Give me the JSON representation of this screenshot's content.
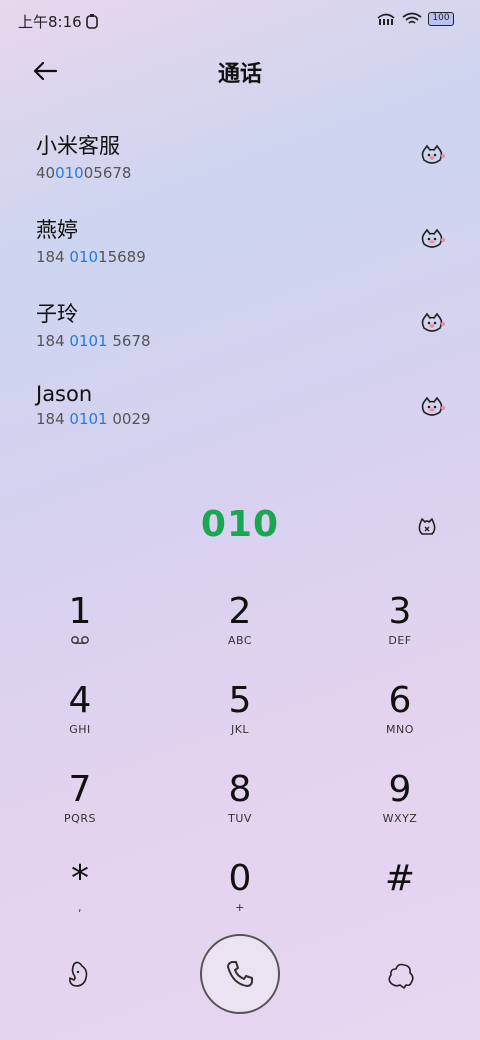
{
  "status_bar": {
    "time": "上午8:16",
    "battery": "100"
  },
  "header": {
    "title": "通话"
  },
  "contacts": [
    {
      "name": "小米客服",
      "number_pre": "40",
      "number_match": "010",
      "number_post": "05678"
    },
    {
      "name": "燕婷",
      "number_pre": "184 ",
      "number_match": "010",
      "number_post": "15689"
    },
    {
      "name": "子玲",
      "number_pre": "184 ",
      "number_match": "0101",
      "number_post": " 5678"
    },
    {
      "name": "Jason",
      "number_pre": "184 ",
      "number_match": "0101",
      "number_post": " 0029"
    }
  ],
  "dialer": {
    "input": "010"
  },
  "keypad": [
    [
      {
        "digit": "1",
        "letters": ""
      },
      {
        "digit": "2",
        "letters": "ABC"
      },
      {
        "digit": "3",
        "letters": "DEF"
      }
    ],
    [
      {
        "digit": "4",
        "letters": "GHI"
      },
      {
        "digit": "5",
        "letters": "JKL"
      },
      {
        "digit": "6",
        "letters": "MNO"
      }
    ],
    [
      {
        "digit": "7",
        "letters": "PQRS"
      },
      {
        "digit": "8",
        "letters": "TUV"
      },
      {
        "digit": "9",
        "letters": "WXYZ"
      }
    ],
    [
      {
        "digit": "*",
        "letters": ","
      },
      {
        "digit": "0",
        "letters": "+"
      },
      {
        "digit": "#",
        "letters": ""
      }
    ]
  ],
  "colors": {
    "highlight": "#2979d8",
    "dialed_text": "#1aa653"
  },
  "icons": {
    "back": "arrow-left-icon",
    "contact_action": "cat-head-icon",
    "delete": "backspace-icon",
    "voicemail": "voicemail-icon",
    "call": "phone-icon",
    "left_action": "mascot-icon",
    "right_action": "cloud-icon"
  }
}
